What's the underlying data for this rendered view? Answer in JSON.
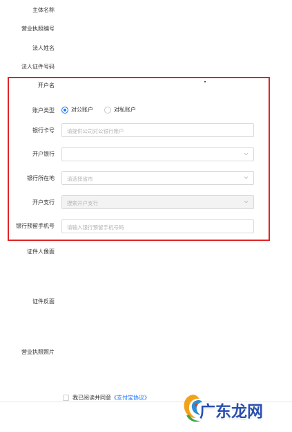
{
  "form": {
    "subject_name_label": "主体名称",
    "business_license_no_label": "营业执照编号",
    "legal_person_name_label": "法人姓名",
    "legal_person_id_label": "法人证件号码",
    "account_name_label": "开户名",
    "account_type_label": "账户类型",
    "account_type_options": [
      "对公账户",
      "对私账户"
    ],
    "account_type_selected": "对公账户",
    "bank_card_label": "银行卡号",
    "bank_card_placeholder": "请提供公司对公银行账户",
    "bank_label": "开户银行",
    "bank_value": "",
    "bank_location_label": "银行所在地",
    "bank_location_placeholder": "请选择省市",
    "branch_label": "开户支行",
    "branch_placeholder": "搜索开户支行",
    "phone_label": "银行预留手机号",
    "phone_placeholder": "请输入银行预留手机号码",
    "id_front_label": "证件人像面",
    "id_back_label": "证件反面",
    "license_photo_label": "营业执照照片",
    "agree_text": "我已阅读并同意",
    "agree_link": "《支付宝协议》"
  },
  "watermark": {
    "text": "广东龙网"
  },
  "colors": {
    "highlight_border": "#e02525",
    "accent": "#1677ff",
    "placeholder": "#b3b3b3"
  }
}
